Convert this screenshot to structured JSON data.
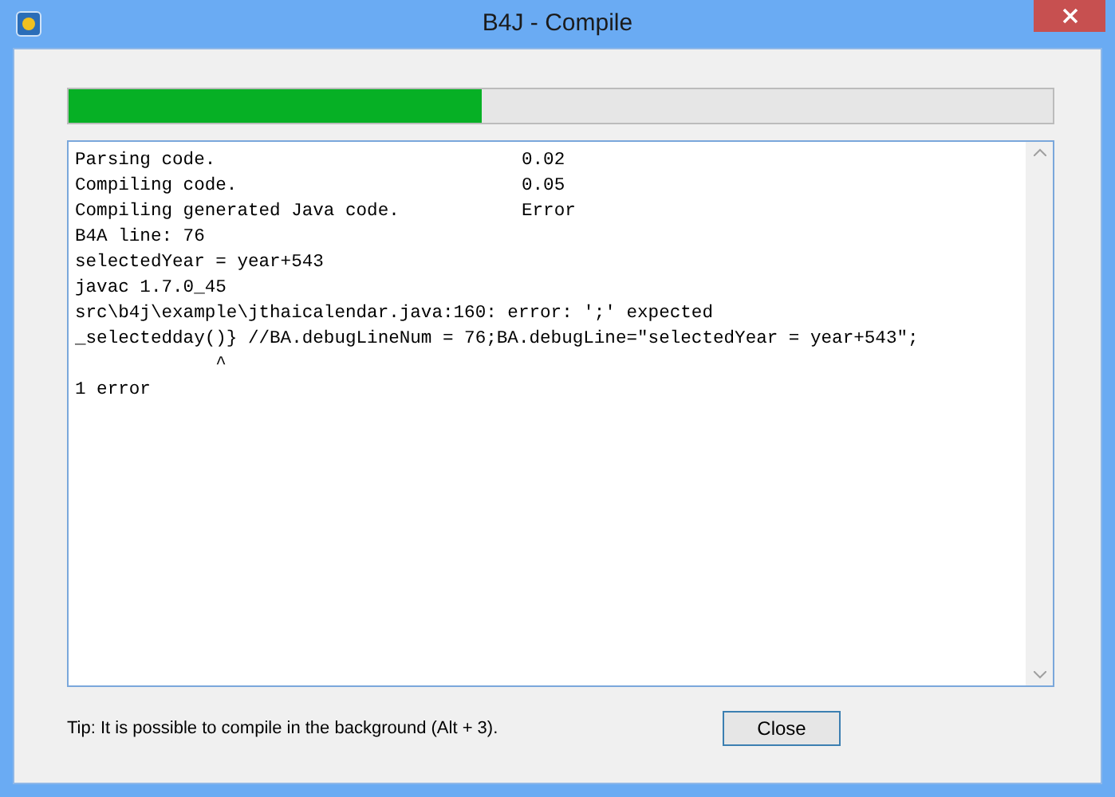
{
  "window": {
    "title": "B4J - Compile"
  },
  "progress": {
    "level": 0.42
  },
  "log": [
    {
      "text": "Parsing code.",
      "value": "0.02"
    },
    {
      "text": "Compiling code.",
      "value": "0.05"
    },
    {
      "text": "Compiling generated Java code.",
      "value": "Error"
    },
    {
      "text": "B4A line: 76"
    },
    {
      "text": "selectedYear = year+543"
    },
    {
      "text": "javac 1.7.0_45"
    },
    {
      "text": "src\\b4j\\example\\jthaicalendar.java:160: error: ';' expected"
    },
    {
      "text": "_selectedday()} //BA.debugLineNum = 76;BA.debugLine=\"selectedYear = year+543\";"
    },
    {
      "text": "             ^"
    },
    {
      "text": "1 error"
    }
  ],
  "tip": "Tip: It is possible to compile in the background (Alt + 3).",
  "buttons": [
    "Close"
  ]
}
